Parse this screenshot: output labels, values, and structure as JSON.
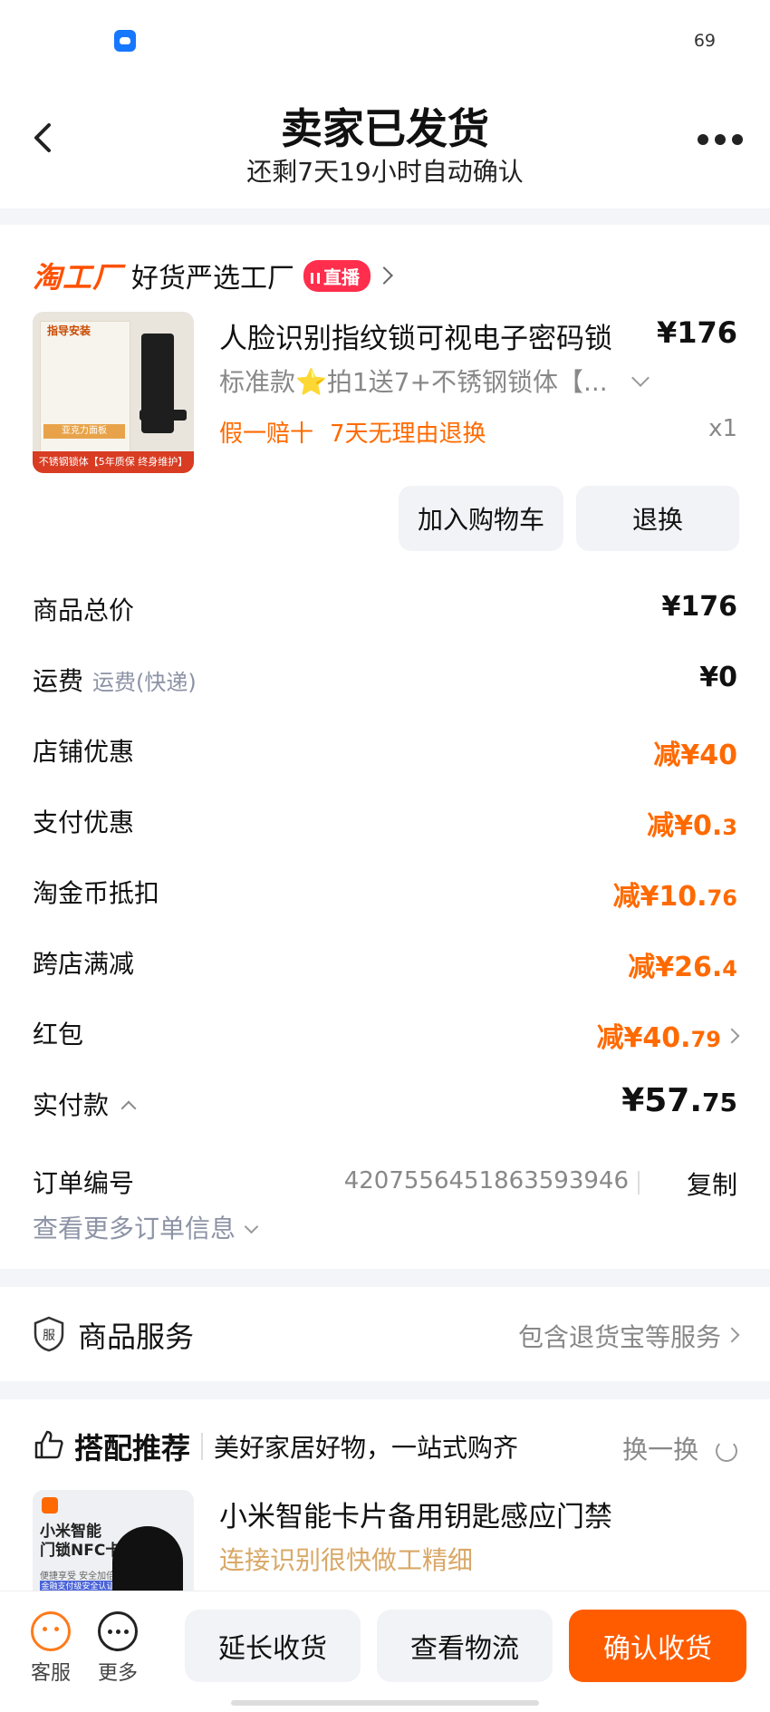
{
  "status": {
    "battery": "69"
  },
  "header": {
    "title": "卖家已发货",
    "subtitle": "还剩7天19小时自动确认"
  },
  "shop": {
    "logo": "淘工厂",
    "name": "好货严选工厂",
    "live_badge": "直播"
  },
  "product": {
    "image_title": "指导安装",
    "image_tag": "亚克力面板",
    "image_strip": "不锈钢锁体【5年质保 终身维护】",
    "title": "人脸识别指纹锁可视电子密码锁",
    "price": "¥176",
    "spec": "标准款⭐拍1送7+不锈钢锁体【...",
    "tags": [
      "假一赔十",
      "7天无理由退换"
    ],
    "qty": "x1",
    "add_cart_label": "加入购物车",
    "return_label": "退换"
  },
  "summary": {
    "rows": [
      {
        "label": "商品总价",
        "sub": "",
        "value": "¥176",
        "small": "",
        "orange": false
      },
      {
        "label": "运费",
        "sub": "运费(快递)",
        "value": "¥0",
        "small": "",
        "orange": false
      },
      {
        "label": "店铺优惠",
        "sub": "",
        "value": "减¥40",
        "small": "",
        "orange": true
      },
      {
        "label": "支付优惠",
        "sub": "",
        "value": "减¥0.",
        "small": "3",
        "orange": true
      },
      {
        "label": "淘金币抵扣",
        "sub": "",
        "value": "减¥10.",
        "small": "76",
        "orange": true
      },
      {
        "label": "跨店满减",
        "sub": "",
        "value": "减¥26.",
        "small": "4",
        "orange": true
      },
      {
        "label": "红包",
        "sub": "",
        "value": "减¥40.",
        "small": "79",
        "orange": true
      }
    ],
    "paid_label": "实付款",
    "paid_value": "¥57.",
    "paid_small": "75",
    "order_label": "订单编号",
    "order_number": "4207556451863593946",
    "copy_label": "复制",
    "more_info": "查看更多订单信息"
  },
  "service": {
    "label": "商品服务",
    "detail": "包含退货宝等服务"
  },
  "recommend": {
    "title": "搭配推荐",
    "slogan": "美好家居好物，一站式购齐",
    "swap": "换一换",
    "item_title": "小米智能卡片备用钥匙感应门禁",
    "item_sub": "连接识别很快做工精细",
    "img_text": "小米智能\n门锁NFC卡",
    "img_sub": "便捷享受 安全加倍",
    "img_badge": "金融支付级安全认证"
  },
  "bottom": {
    "service_label": "客服",
    "more_label": "更多",
    "extend_label": "延长收货",
    "logistics_label": "查看物流",
    "confirm_label": "确认收货"
  },
  "colors": {
    "accent": "#ff5000",
    "orange_text": "#ff6a00",
    "live_red": "#ff2e4d"
  }
}
